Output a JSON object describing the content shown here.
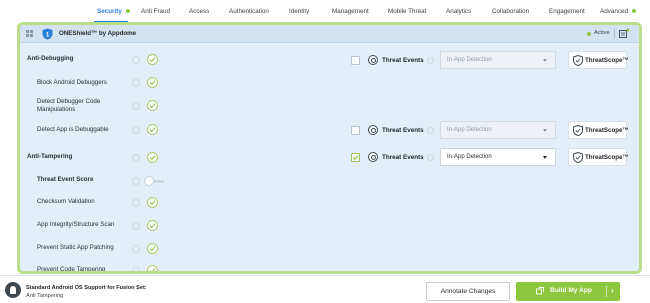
{
  "nav": {
    "items": [
      {
        "label": "Security",
        "active": true,
        "dot": true
      },
      {
        "label": "Anti Fraud"
      },
      {
        "label": "Access"
      },
      {
        "label": "Authentication"
      },
      {
        "label": "Identity"
      },
      {
        "label": "Management"
      },
      {
        "label": "Mobile Threat"
      },
      {
        "label": "Analytics"
      },
      {
        "label": "Collaboration"
      },
      {
        "label": "Engagement"
      },
      {
        "label": "Advanced",
        "dot": true
      }
    ]
  },
  "panel": {
    "title": "ONEShield™ by Appdome",
    "status": "Active",
    "accent_color": "#8dc63f",
    "border_color": "#b9dd8a"
  },
  "rows": [
    {
      "label": "Anti-Debugging",
      "bold": true
    },
    {
      "label": "Block Android Debuggers"
    },
    {
      "label": "Detect Debugger Code Manipulations"
    },
    {
      "label": "Detect App is Debuggable"
    },
    {
      "label": "Anti-Tampering",
      "bold": true
    },
    {
      "label": "Threat Event Score",
      "toggle_on": false
    },
    {
      "label": "Checksum Validation"
    },
    {
      "label": "App Integrity/Structure Scan"
    },
    {
      "label": "Prevent Static App Patching"
    },
    {
      "label": "Prevent Code Tampering"
    }
  ],
  "threat_rows": [
    {
      "checked": false,
      "label": "Threat Events",
      "select": "In-App Detection",
      "enabled": false,
      "scope": "ThreatScope™"
    },
    {
      "checked": false,
      "label": "Threat Events",
      "select": "In-App Detection",
      "enabled": false,
      "scope": "ThreatScope™"
    },
    {
      "checked": true,
      "label": "Threat Events",
      "select": "In-App Detection",
      "enabled": true,
      "scope": "ThreatScope™"
    }
  ],
  "footer": {
    "line1": "Standard Android OS Support for Fusion Set:",
    "line2": "Anti Tampering",
    "annotate": "Annotate Changes",
    "build": "Build My App"
  }
}
